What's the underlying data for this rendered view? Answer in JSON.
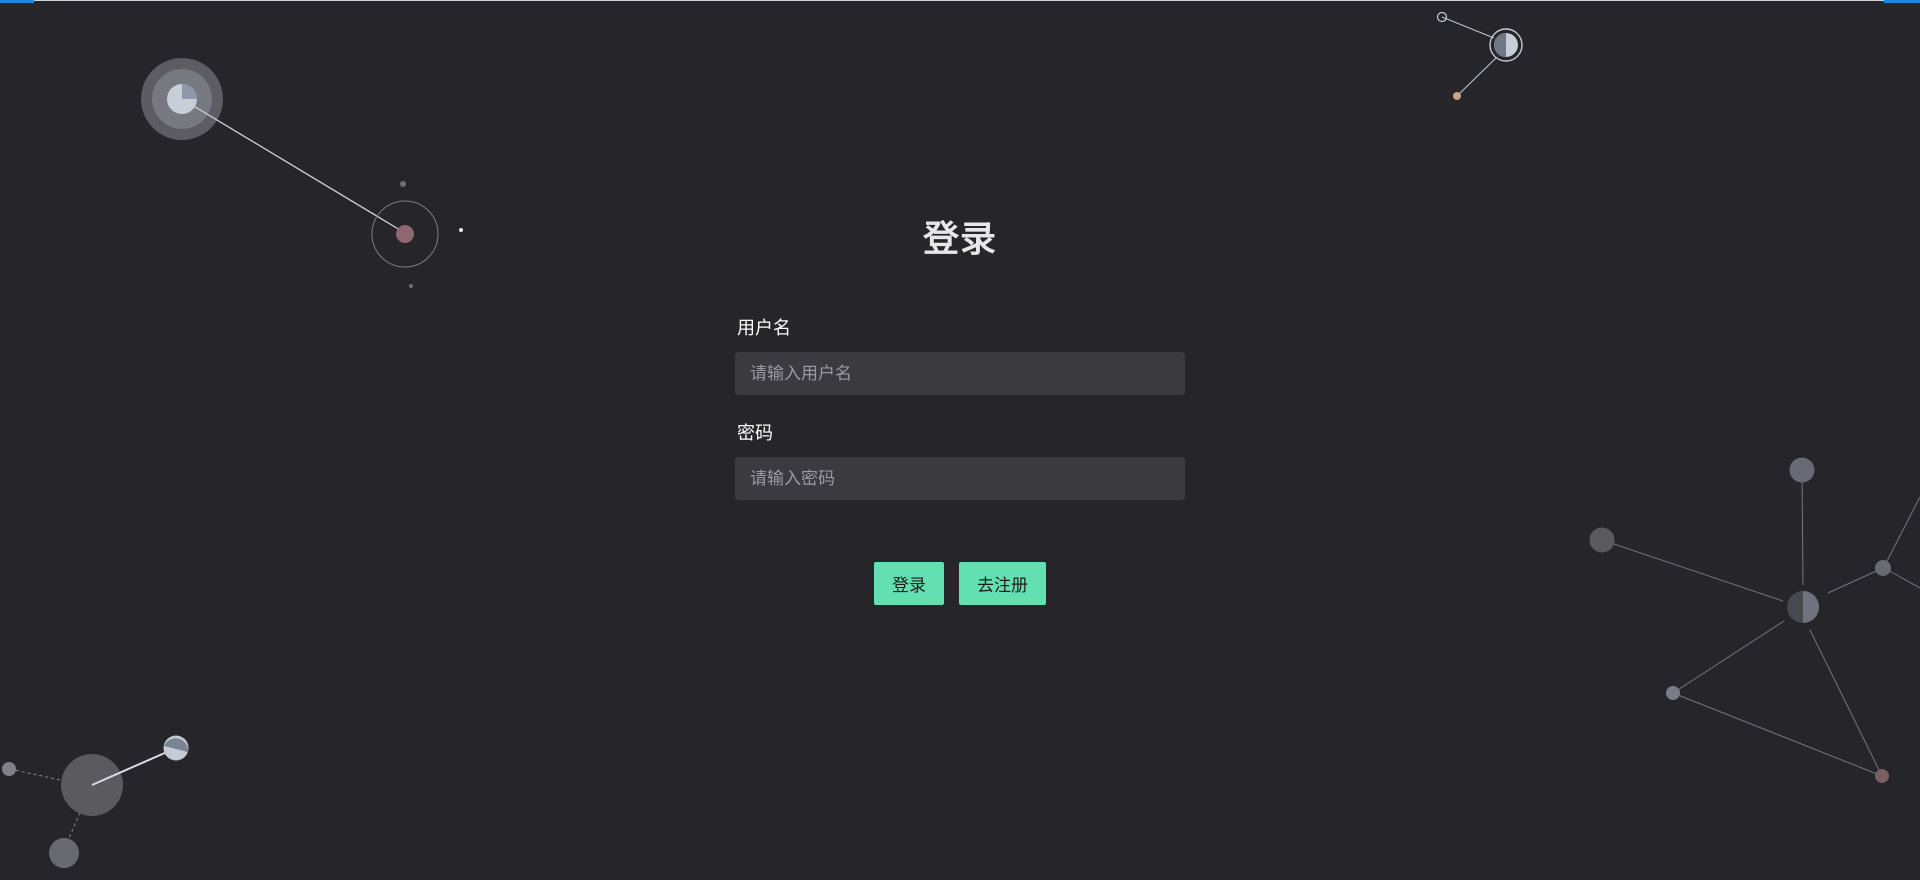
{
  "login": {
    "title": "登录",
    "username_label": "用户名",
    "username_placeholder": "请输入用户名",
    "username_value": "",
    "password_label": "密码",
    "password_placeholder": "请输入密码",
    "password_value": "",
    "login_button": "登录",
    "register_button": "去注册"
  },
  "colors": {
    "background": "#25252a",
    "input_background": "#3a3a3f",
    "button_green": "#63e0b2",
    "accent_blue": "#1e88e5",
    "text": "#e7e7e8"
  },
  "icons": [
    "network-node-graphic"
  ]
}
